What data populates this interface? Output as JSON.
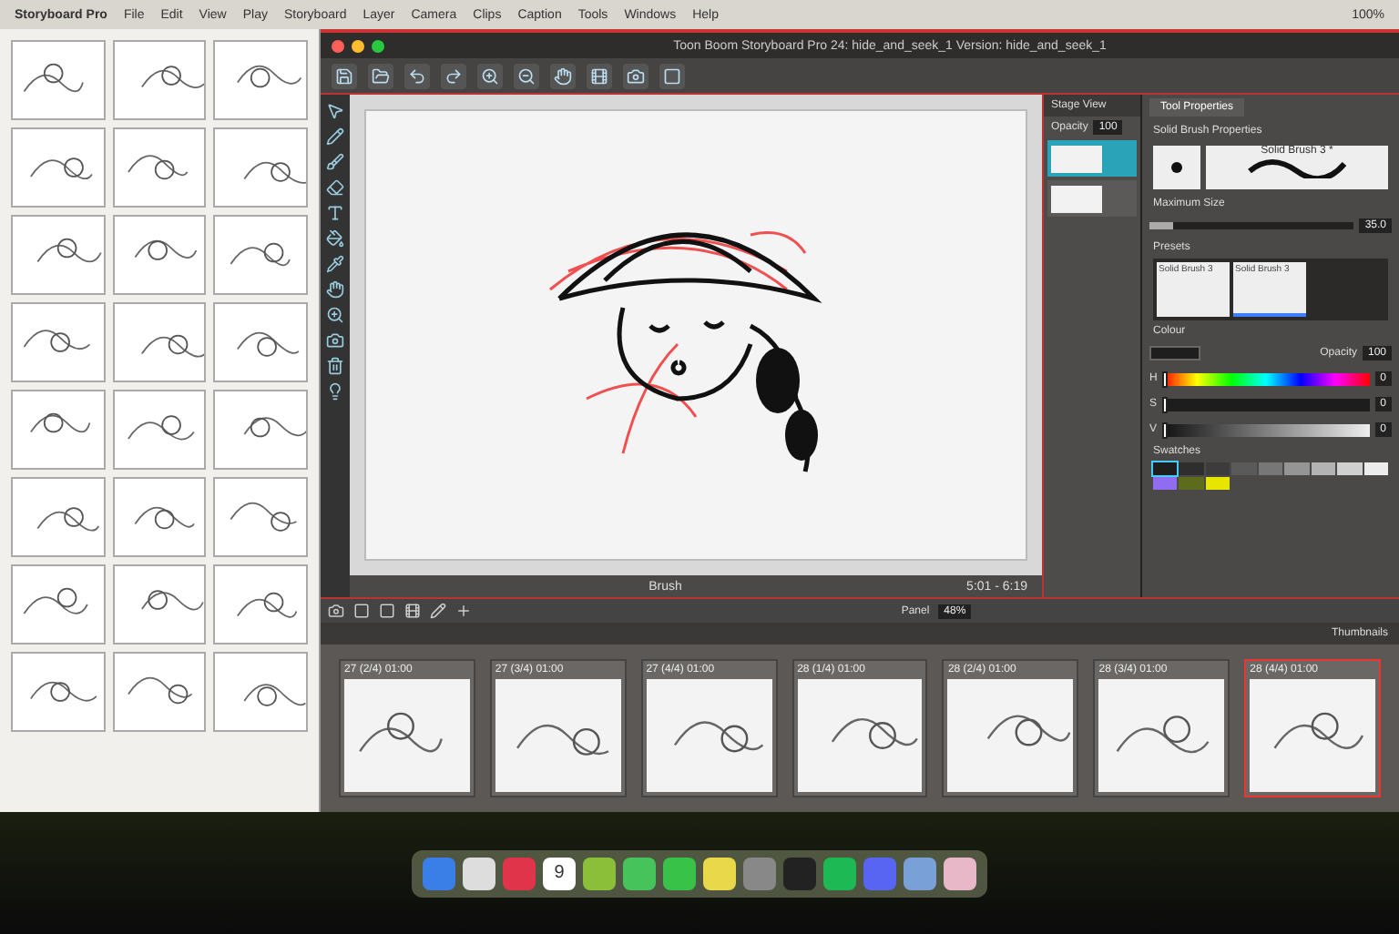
{
  "menu_bar": {
    "app": "Storyboard Pro",
    "items": [
      "File",
      "Edit",
      "View",
      "Play",
      "Storyboard",
      "Layer",
      "Camera",
      "Clips",
      "Caption",
      "Tools",
      "Windows",
      "Help"
    ],
    "battery": "100%"
  },
  "main_window": {
    "title": "Toon Boom Storyboard Pro 24: hide_and_seek_1 Version: hide_and_seek_1"
  },
  "stage": {
    "tool": "Brush",
    "range": "5:01 - 6:19"
  },
  "layers": {
    "title": "Stage View",
    "opacity_label": "Opacity",
    "opacity": "100",
    "rows": [
      {
        "selected": true
      },
      {
        "selected": false
      }
    ]
  },
  "tool_properties": {
    "tabs": [
      {
        "label": "Tool Properties",
        "selected": true
      }
    ],
    "section": "Solid Brush Properties",
    "brush_name": "Solid Brush 3 *",
    "size_label": "Maximum Size",
    "size": "35.0",
    "size_slider": {
      "level": 0.12
    },
    "presets_label": "Presets",
    "presets": [
      {
        "label": "Solid Brush 3",
        "selected": false
      },
      {
        "label": "Solid Brush 3",
        "selected": true
      }
    ],
    "colour_label": "Colour",
    "opacity_label": "Opacity",
    "opacity": "100",
    "channels": [
      {
        "label": "H",
        "value": "0",
        "level": 0
      },
      {
        "label": "S",
        "value": "0",
        "level": 0
      },
      {
        "label": "V",
        "value": "0",
        "level": 0
      }
    ],
    "swatches_label": "Swatches",
    "swatches": [
      {
        "color": "#1e1e1e",
        "selected": true
      },
      {
        "color": "#2e2e2e",
        "selected": false
      },
      {
        "color": "#3c3c3c",
        "selected": false
      },
      {
        "color": "#5a5a5a",
        "selected": false
      },
      {
        "color": "#777777",
        "selected": false
      },
      {
        "color": "#959595",
        "selected": false
      },
      {
        "color": "#b3b3b3",
        "selected": false
      },
      {
        "color": "#d0d0d0",
        "selected": false
      },
      {
        "color": "#ececec",
        "selected": false
      },
      {
        "color": "#8f6cf0",
        "selected": false
      },
      {
        "color": "#5d6b1c",
        "selected": false
      },
      {
        "color": "#e6e600",
        "selected": false
      }
    ]
  },
  "bottom_toolbar": {
    "panel_label": "Panel",
    "zoom": "48%"
  },
  "thumbnails": {
    "title": "Thumbnails",
    "items": [
      {
        "label": "27 (2/4) 01:00",
        "selected": false
      },
      {
        "label": "27 (3/4) 01:00",
        "selected": false
      },
      {
        "label": "27 (4/4) 01:00",
        "selected": false
      },
      {
        "label": "28 (1/4) 01:00",
        "selected": false
      },
      {
        "label": "28 (2/4) 01:00",
        "selected": false
      },
      {
        "label": "28 (3/4) 01:00",
        "selected": false
      },
      {
        "label": "28 (4/4) 01:00",
        "selected": true
      }
    ]
  },
  "dock": {
    "calendar_day": "9"
  }
}
